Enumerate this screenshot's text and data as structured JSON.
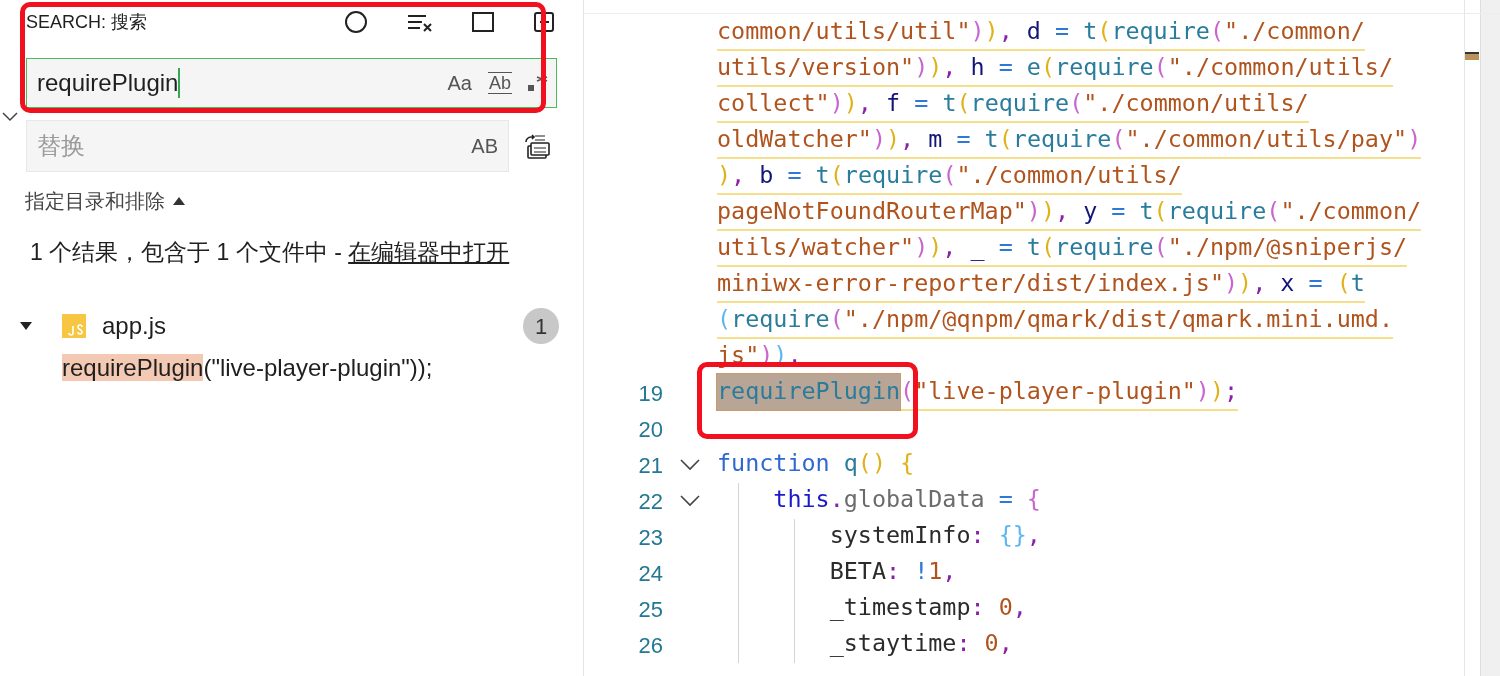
{
  "search_panel": {
    "title": "SEARCH: 搜索",
    "search": {
      "value": "requirePlugin",
      "focused": true,
      "match_case": "Aa",
      "whole_word": "Ab"
    },
    "replace_expanded": true,
    "replace": {
      "placeholder": "替换",
      "preserve_case": "AB"
    },
    "include_exclude": {
      "label": "指定目录和排除",
      "expanded": true
    },
    "summary": "1 个结果，包含于 1 个文件中 - ",
    "open_link": "在编辑器中打开",
    "files": [
      {
        "name": "app.js",
        "count": "1",
        "expanded": true,
        "matches": [
          {
            "match": "requirePlugin",
            "rest": "(\"live-player-plugin\"));"
          }
        ]
      }
    ]
  },
  "editor": {
    "rows": [
      {
        "underlined": true,
        "tokens": [
          {
            "kind": "s",
            "text": "common/utils/util\""
          },
          {
            "kind": "p2",
            "text": ")"
          },
          {
            "kind": "p1",
            "text": ")"
          },
          {
            "kind": "c",
            "text": ", "
          },
          {
            "kind": "v",
            "text": "d"
          },
          {
            "kind": "o",
            "text": " = "
          },
          {
            "kind": "f",
            "text": "t"
          },
          {
            "kind": "p1",
            "text": "("
          },
          {
            "kind": "f",
            "text": "require"
          },
          {
            "kind": "p2",
            "text": "("
          },
          {
            "kind": "s",
            "text": "\"./common/"
          }
        ]
      },
      {
        "underlined": true,
        "tokens": [
          {
            "kind": "s",
            "text": "utils/version\""
          },
          {
            "kind": "p2",
            "text": ")"
          },
          {
            "kind": "p1",
            "text": ")"
          },
          {
            "kind": "c",
            "text": ", "
          },
          {
            "kind": "v",
            "text": "h"
          },
          {
            "kind": "o",
            "text": " = "
          },
          {
            "kind": "f",
            "text": "e"
          },
          {
            "kind": "p1",
            "text": "("
          },
          {
            "kind": "f",
            "text": "require"
          },
          {
            "kind": "p2",
            "text": "("
          },
          {
            "kind": "s",
            "text": "\"./common/utils/"
          }
        ]
      },
      {
        "underlined": true,
        "tokens": [
          {
            "kind": "s",
            "text": "collect\""
          },
          {
            "kind": "p2",
            "text": ")"
          },
          {
            "kind": "p1",
            "text": ")"
          },
          {
            "kind": "c",
            "text": ", "
          },
          {
            "kind": "v",
            "text": "f"
          },
          {
            "kind": "o",
            "text": " = "
          },
          {
            "kind": "f",
            "text": "t"
          },
          {
            "kind": "p1",
            "text": "("
          },
          {
            "kind": "f",
            "text": "require"
          },
          {
            "kind": "p2",
            "text": "("
          },
          {
            "kind": "s",
            "text": "\"./common/utils/"
          }
        ]
      },
      {
        "underlined": true,
        "tokens": [
          {
            "kind": "s",
            "text": "oldWatcher\""
          },
          {
            "kind": "p2",
            "text": ")"
          },
          {
            "kind": "p1",
            "text": ")"
          },
          {
            "kind": "c",
            "text": ", "
          },
          {
            "kind": "v",
            "text": "m"
          },
          {
            "kind": "o",
            "text": " = "
          },
          {
            "kind": "f",
            "text": "t"
          },
          {
            "kind": "p1",
            "text": "("
          },
          {
            "kind": "f",
            "text": "require"
          },
          {
            "kind": "p2",
            "text": "("
          },
          {
            "kind": "s",
            "text": "\"./common/utils/pay\""
          },
          {
            "kind": "p2",
            "text": ")"
          }
        ]
      },
      {
        "underlined": true,
        "tokens": [
          {
            "kind": "p1",
            "text": ")"
          },
          {
            "kind": "c",
            "text": ", "
          },
          {
            "kind": "v",
            "text": "b"
          },
          {
            "kind": "o",
            "text": " = "
          },
          {
            "kind": "f",
            "text": "t"
          },
          {
            "kind": "p1",
            "text": "("
          },
          {
            "kind": "f",
            "text": "require"
          },
          {
            "kind": "p2",
            "text": "("
          },
          {
            "kind": "s",
            "text": "\"./common/utils/"
          }
        ]
      },
      {
        "underlined": true,
        "tokens": [
          {
            "kind": "s",
            "text": "pageNotFoundRouterMap\""
          },
          {
            "kind": "p2",
            "text": ")"
          },
          {
            "kind": "p1",
            "text": ")"
          },
          {
            "kind": "c",
            "text": ", "
          },
          {
            "kind": "v",
            "text": "y"
          },
          {
            "kind": "o",
            "text": " = "
          },
          {
            "kind": "f",
            "text": "t"
          },
          {
            "kind": "p1",
            "text": "("
          },
          {
            "kind": "f",
            "text": "require"
          },
          {
            "kind": "p2",
            "text": "("
          },
          {
            "kind": "s",
            "text": "\"./common/"
          }
        ]
      },
      {
        "underlined": true,
        "tokens": [
          {
            "kind": "s",
            "text": "utils/watcher\""
          },
          {
            "kind": "p2",
            "text": ")"
          },
          {
            "kind": "p1",
            "text": ")"
          },
          {
            "kind": "c",
            "text": ", "
          },
          {
            "kind": "v",
            "text": "_"
          },
          {
            "kind": "o",
            "text": " = "
          },
          {
            "kind": "f",
            "text": "t"
          },
          {
            "kind": "p1",
            "text": "("
          },
          {
            "kind": "f",
            "text": "require"
          },
          {
            "kind": "p2",
            "text": "("
          },
          {
            "kind": "s",
            "text": "\"./npm/@sniperjs/"
          }
        ]
      },
      {
        "underlined": true,
        "tokens": [
          {
            "kind": "s",
            "text": "miniwx-error-reporter/dist/index.js\""
          },
          {
            "kind": "p2",
            "text": ")"
          },
          {
            "kind": "p1",
            "text": ")"
          },
          {
            "kind": "c",
            "text": ", "
          },
          {
            "kind": "v",
            "text": "x"
          },
          {
            "kind": "o",
            "text": " = "
          },
          {
            "kind": "p1",
            "text": "("
          },
          {
            "kind": "f",
            "text": "t"
          }
        ]
      },
      {
        "underlined": true,
        "tokens": [
          {
            "kind": "p3",
            "text": "("
          },
          {
            "kind": "f",
            "text": "require"
          },
          {
            "kind": "p2",
            "text": "("
          },
          {
            "kind": "s",
            "text": "\"./npm/@qnpm/qmark/dist/qmark.mini.umd."
          }
        ]
      },
      {
        "tokens": [
          {
            "kind": "s",
            "text": "js\""
          },
          {
            "kind": "p2",
            "text": ")"
          },
          {
            "kind": "p3",
            "text": ")"
          },
          {
            "kind": "c",
            "text": ","
          }
        ]
      },
      {
        "number": "19",
        "underlined": true,
        "tokens": [
          {
            "kind": "f",
            "text": "requirePlugin",
            "match": true
          },
          {
            "kind": "p2",
            "text": "("
          },
          {
            "kind": "s",
            "text": "\"live-player-plugin\""
          },
          {
            "kind": "p2",
            "text": ")"
          },
          {
            "kind": "p1",
            "text": ")"
          },
          {
            "kind": "c",
            "text": ";"
          }
        ]
      },
      {
        "number": "20",
        "tokens": []
      },
      {
        "number": "21",
        "underlined": false,
        "folded": false,
        "tokens": [
          {
            "kind": "k",
            "text": "function "
          },
          {
            "kind": "f",
            "text": "q"
          },
          {
            "kind": "p1",
            "text": "() {"
          }
        ]
      },
      {
        "number": "22",
        "underlined": false,
        "folded": false,
        "tokens": [
          {
            "kind": "th",
            "text": "    this"
          },
          {
            "kind": "c",
            "text": "."
          },
          {
            "kind": "m",
            "text": "globalData"
          },
          {
            "kind": "o",
            "text": " = "
          },
          {
            "kind": "p2",
            "text": "{"
          }
        ]
      },
      {
        "number": "23",
        "underlined": false,
        "tokens": [
          {
            "kind": "pr",
            "text": "        systemInfo"
          },
          {
            "kind": "c",
            "text": ": "
          },
          {
            "kind": "p3",
            "text": "{}"
          },
          {
            "kind": "c",
            "text": ","
          }
        ]
      },
      {
        "number": "24",
        "underlined": false,
        "tokens": [
          {
            "kind": "pr",
            "text": "        BETA"
          },
          {
            "kind": "c",
            "text": ": "
          },
          {
            "kind": "o",
            "text": "!"
          },
          {
            "kind": "n",
            "text": "1"
          },
          {
            "kind": "c",
            "text": ","
          }
        ]
      },
      {
        "number": "25",
        "underlined": false,
        "tokens": [
          {
            "kind": "pr",
            "text": "        _timestamp"
          },
          {
            "kind": "c",
            "text": ": "
          },
          {
            "kind": "n",
            "text": "0"
          },
          {
            "kind": "c",
            "text": ","
          }
        ]
      },
      {
        "number": "26",
        "underlined": false,
        "tokens": [
          {
            "kind": "pr",
            "text": "        _staytime"
          },
          {
            "kind": "c",
            "text": ": "
          },
          {
            "kind": "n",
            "text": "0"
          },
          {
            "kind": "c",
            "text": ","
          }
        ]
      }
    ]
  }
}
